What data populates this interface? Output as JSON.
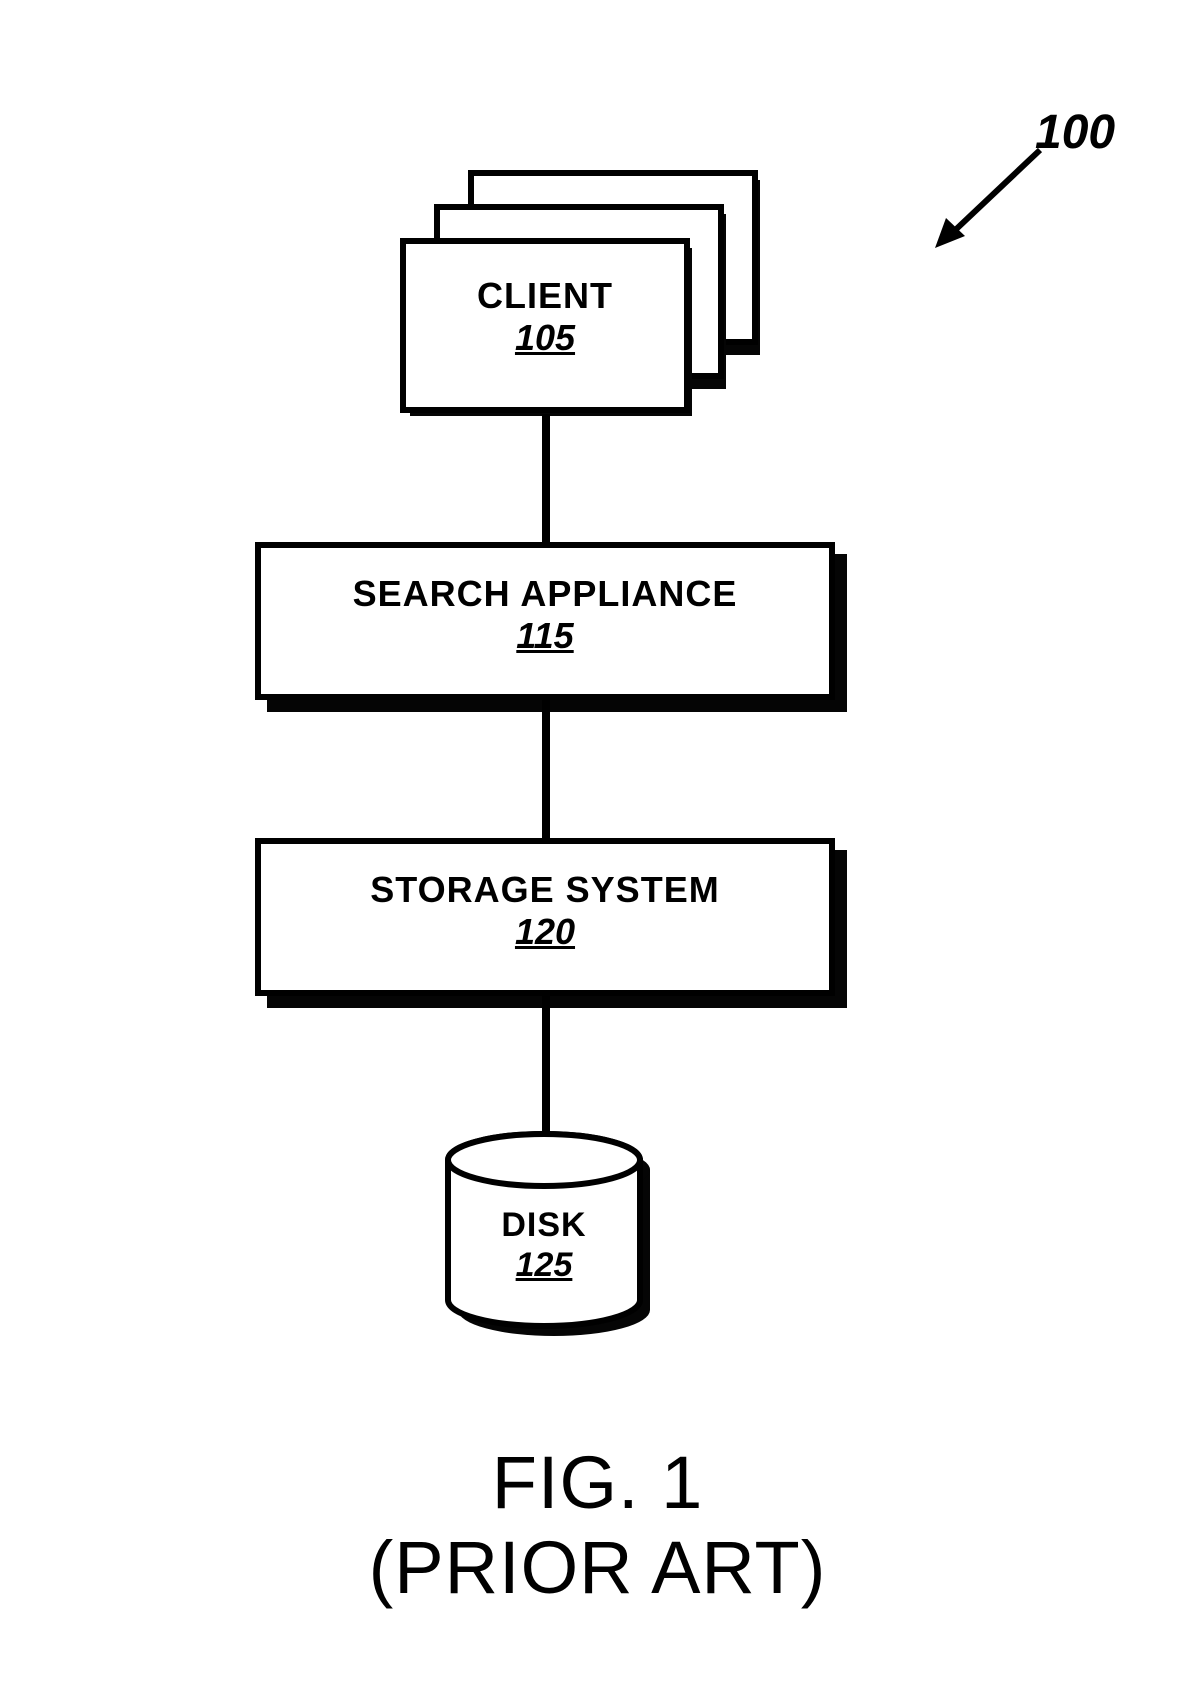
{
  "ref": {
    "figure_ref": "100"
  },
  "client": {
    "title": "CLIENT",
    "num": "105"
  },
  "search": {
    "title": "SEARCH APPLIANCE",
    "num": "115"
  },
  "storage": {
    "title": "STORAGE SYSTEM",
    "num": "120"
  },
  "disk": {
    "title": "DISK",
    "num": "125"
  },
  "caption": {
    "line1": "FIG. 1",
    "line2": "(PRIOR ART)"
  }
}
